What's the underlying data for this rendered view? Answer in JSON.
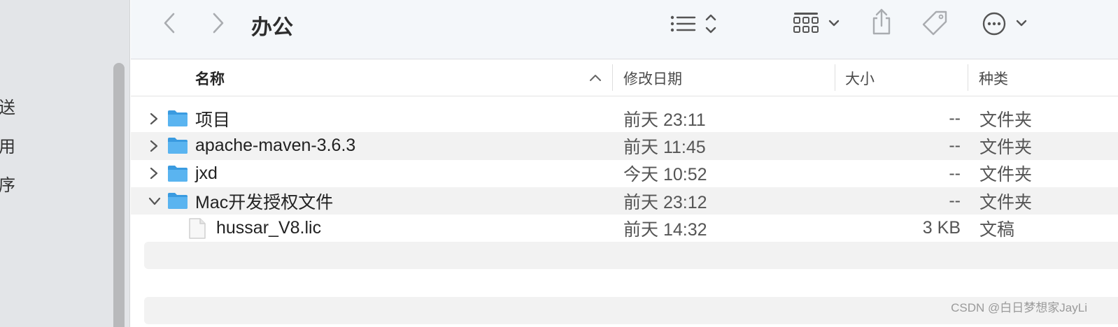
{
  "sidebar": {
    "items": [
      {
        "label": "送"
      },
      {
        "label": "用"
      },
      {
        "label": "序"
      }
    ]
  },
  "toolbar": {
    "title": "办公",
    "icons": [
      "chevron-left-icon",
      "chevron-right-icon",
      "list-view-icon",
      "sort-updown-icon",
      "grid-view-icon",
      "chevron-down-icon",
      "share-icon",
      "tag-icon",
      "more-icon",
      "chevron-down-icon"
    ]
  },
  "columns": {
    "name": "名称",
    "date": "修改日期",
    "size": "大小",
    "kind": "种类"
  },
  "rows": [
    {
      "name": "项目",
      "date": "前天 23:11",
      "size": "--",
      "kind": "文件夹",
      "type": "folder",
      "expanded": false
    },
    {
      "name": "apache-maven-3.6.3",
      "date": "前天 11:45",
      "size": "--",
      "kind": "文件夹",
      "type": "folder",
      "expanded": false
    },
    {
      "name": "jxd",
      "date": "今天 10:52",
      "size": "--",
      "kind": "文件夹",
      "type": "folder",
      "expanded": false
    },
    {
      "name": "Mac开发授权文件",
      "date": "前天 23:12",
      "size": "--",
      "kind": "文件夹",
      "type": "folder",
      "expanded": true
    },
    {
      "name": "hussar_V8.lic",
      "date": "前天 14:32",
      "size": "3 KB",
      "kind": "文稿",
      "type": "file"
    }
  ],
  "watermark": "CSDN @白日梦想家JayLi",
  "colors": {
    "folder": "#5ab4f0",
    "toolbar_bg": "#f4f7fa",
    "sidebar_bg": "#e3e5e8",
    "alt_row": "#f2f2f2"
  }
}
